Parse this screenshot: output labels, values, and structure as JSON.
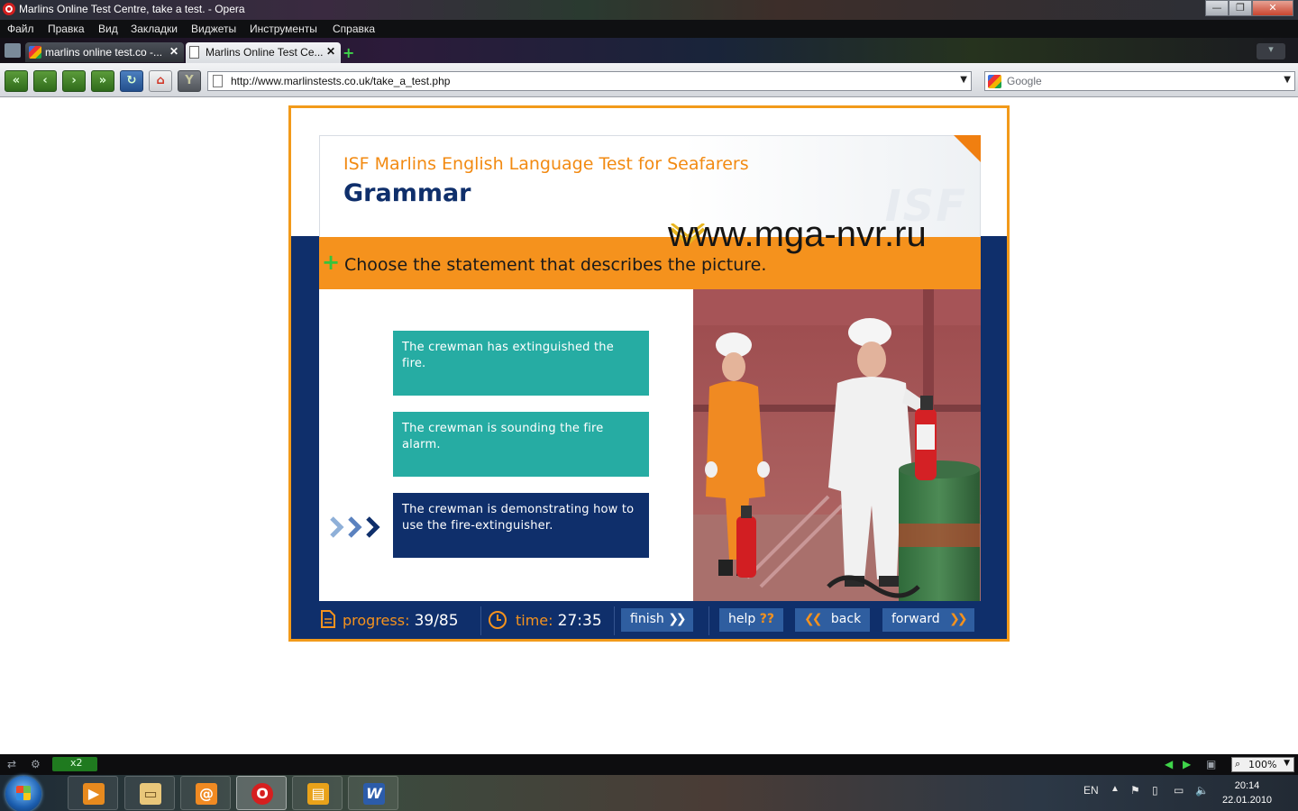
{
  "window": {
    "title": "Marlins Online Test Centre, take a test. - Opera",
    "minimize": "—",
    "maximize": "❐",
    "close": "✕"
  },
  "menu": [
    "Файл",
    "Правка",
    "Вид",
    "Закладки",
    "Виджеты",
    "Инструменты",
    "Справка"
  ],
  "tabs": [
    {
      "label": "marlins online test.co -..."
    },
    {
      "label": "Marlins Online Test Ce..."
    }
  ],
  "toolbar": {
    "url": "http://www.marlinstests.co.uk/take_a_test.php",
    "search_placeholder": "Google"
  },
  "test": {
    "subtitle": "ISF Marlins English Language Test for Seafarers",
    "section": "Grammar",
    "watermark": "www.mga-nvr.ru",
    "instruction": "Choose the statement that describes the picture.",
    "answers": [
      {
        "text": "The crewman has extinguished the fire.",
        "selected": false
      },
      {
        "text": "The crewman is sounding the fire alarm.",
        "selected": false
      },
      {
        "text": "The crewman is demonstrating how to use the fire-extinguisher.",
        "selected": true
      }
    ],
    "progress_label": "progress:",
    "progress_value": "39/85",
    "time_label": "time:",
    "time_value": "27:35",
    "finish_label": "finish",
    "help_label": "help",
    "help_marks": "??",
    "back_label": "back",
    "forward_label": "forward",
    "colors": {
      "frame_border": "#f29a1a",
      "navy": "#0f2f6b",
      "orange": "#f5921d",
      "teal": "#26aca3",
      "button_blue": "#2f5ea0"
    }
  },
  "statusbar": {
    "x2": "x2",
    "zoom": "100%"
  },
  "taskbar": {
    "lang": "EN",
    "time": "20:14",
    "date": "22.01.2010"
  }
}
